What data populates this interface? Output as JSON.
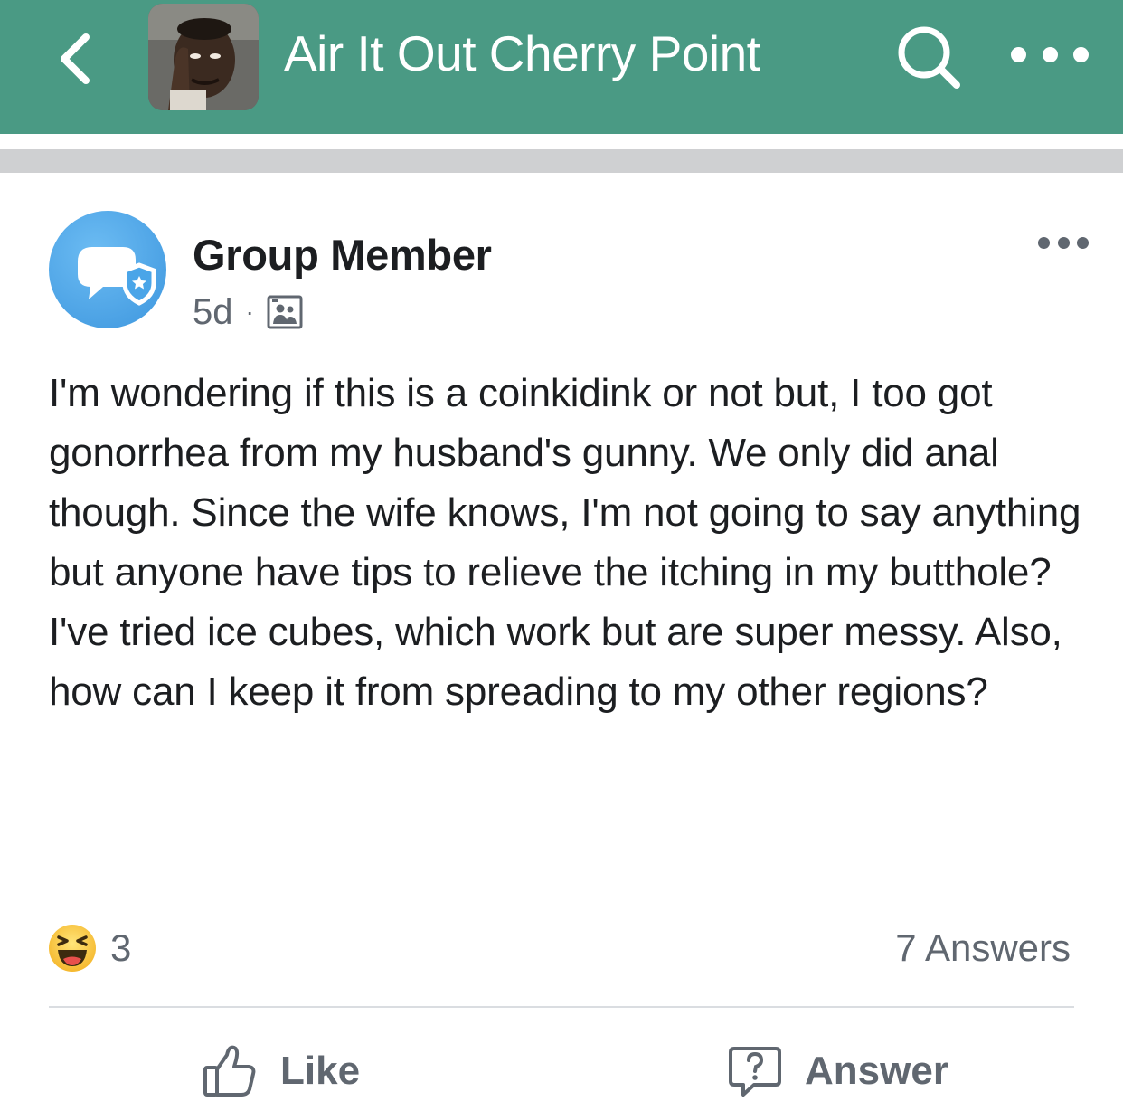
{
  "header": {
    "title": "Air It Out Cherry Point",
    "back_icon": "chevron-left-icon",
    "search_icon": "search-icon",
    "more_icon": "more-horizontal-icon",
    "background_color": "#4a9a84"
  },
  "post": {
    "author": "Group Member",
    "age": "5d",
    "separator": "·",
    "audience_icon": "group-audience-icon",
    "body": "I'm wondering if this is a coinkidink or not but, I too got gonorrhea from my husband's gunny. We only did anal though. Since the wife knows, I'm not going to say anything but anyone have tips to relieve the itching in my butthole? I've tried ice cubes, which work but are super messy. Also, how can I keep it from spreading to my other regions?",
    "reaction_icon": "laughing-emoji-icon",
    "reaction_count": "3",
    "answers_count": "7 Answers"
  },
  "actions": {
    "like_label": "Like",
    "answer_label": "Answer"
  }
}
